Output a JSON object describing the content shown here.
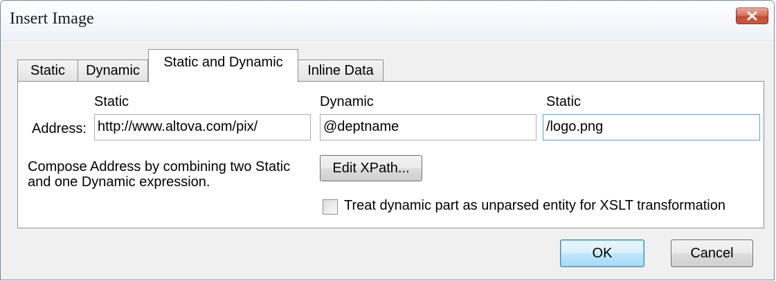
{
  "window": {
    "title": "Insert Image",
    "close_icon": "close-x-icon",
    "close_color": "#c44b31"
  },
  "tabs": [
    {
      "label": "Static",
      "active": false
    },
    {
      "label": "Dynamic",
      "active": false
    },
    {
      "label": "Static and Dynamic",
      "active": true
    },
    {
      "label": "Inline Data",
      "active": false
    }
  ],
  "panel": {
    "address_label": "Address:",
    "columns": [
      {
        "header": "Static",
        "value": "http://www.altova.com/pix/"
      },
      {
        "header": "Dynamic",
        "value": "@deptname"
      },
      {
        "header": "Static",
        "value": "/logo.png"
      }
    ],
    "description_line1": "Compose Address by combining two Static",
    "description_line2": "and one Dynamic expression.",
    "edit_xpath_label": "Edit XPath...",
    "checkbox_label": "Treat dynamic part as unparsed entity for XSLT transformation",
    "checkbox_checked": false
  },
  "footer": {
    "ok_label": "OK",
    "cancel_label": "Cancel"
  }
}
